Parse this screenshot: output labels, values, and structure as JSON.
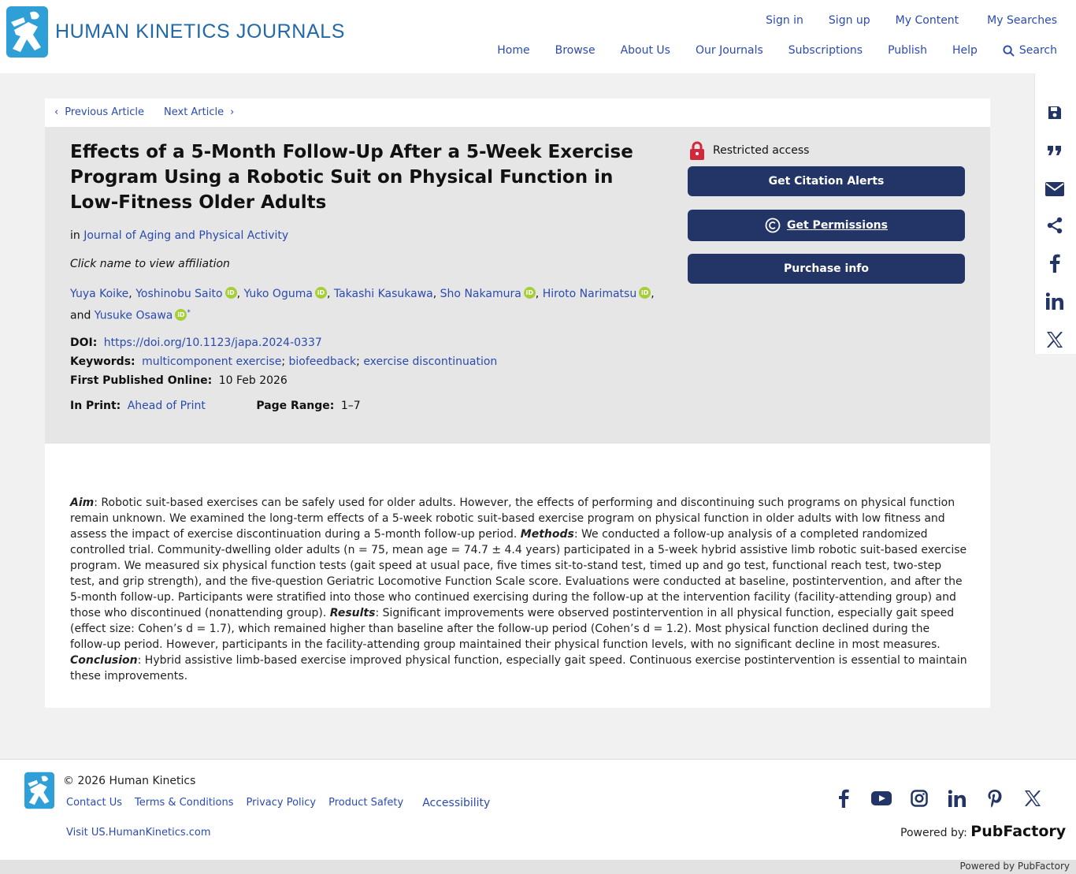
{
  "header": {
    "logo_text": "HUMAN KINETICS JOURNALS",
    "top_links": [
      "Sign in",
      "Sign up",
      "My Content",
      "My Searches"
    ],
    "main_nav": [
      "Home",
      "Browse",
      "About Us",
      "Our Journals",
      "Subscriptions",
      "Publish",
      "Help"
    ],
    "search_label": "Search"
  },
  "sidebar": {
    "icons": [
      "save-icon",
      "quote-icon",
      "email-icon",
      "share-icon",
      "facebook-icon",
      "linkedin-icon",
      "x-icon"
    ]
  },
  "article_nav": {
    "previous": "Previous Article",
    "next": "Next Article"
  },
  "article": {
    "title": "Effects of a 5-Month Follow-Up After a 5-Week Exercise Program Using a Robotic Suit on Physical Function in Low-Fitness Older Adults",
    "in_label": "in",
    "journal": "Journal of Aging and Physical Activity",
    "affiliation_hint": "Click name to view affiliation",
    "authors": [
      {
        "name": "Yuya Koike",
        "orcid": false
      },
      {
        "name": "Yoshinobu Saito",
        "orcid": true
      },
      {
        "name": "Yuko Oguma",
        "orcid": true
      },
      {
        "name": "Takashi Kasukawa",
        "orcid": false
      },
      {
        "name": "Sho Nakamura",
        "orcid": true
      },
      {
        "name": "Hiroto Narimatsu",
        "orcid": true
      },
      {
        "name": "Yusuke Osawa",
        "orcid": true,
        "corresponding": true
      }
    ],
    "and_label": "and",
    "doi_label": "DOI:",
    "doi": "https://doi.org/10.1123/japa.2024-0337",
    "keywords_label": "Keywords:",
    "keywords": [
      "multicomponent exercise",
      "biofeedback",
      "exercise discontinuation"
    ],
    "first_published_label": "First Published Online:",
    "first_published": "10 Feb 2026",
    "in_print_label": "In Print:",
    "in_print": "Ahead of Print",
    "page_range_label": "Page Range:",
    "page_range": "1–7"
  },
  "access": {
    "restricted": "Restricted access",
    "citation_alerts": "Get Citation Alerts",
    "permissions": "Get Permissions",
    "purchase": "Purchase info"
  },
  "abstract": {
    "aim_label": "Aim",
    "aim": ": Robotic suit-based exercises can be safely used for older adults. However, the effects of performing and discontinuing such programs on physical function remain unknown. We examined the long-term effects of a 5-week robotic suit-based exercise program on physical function in older adults with low fitness and assess the impact of exercise discontinuation during a 5-month follow-up period. ",
    "methods_label": "Methods",
    "methods": ": We conducted a follow-up analysis of a completed randomized controlled trial. Community-dwelling older adults (n = 75, mean age = 74.7 ± 4.4 years) participated in a 5-week hybrid assistive limb robotic suit-based exercise program. We measured six physical function tests (gait speed at usual pace, five times sit-to-stand test, timed up and go test, functional reach test, two-step test, and grip strength), and the five-question Geriatric Locomotive Function Scale score. Evaluations were conducted at baseline, postintervention, and after the 5-month follow-up. Participants were stratified into those who continued exercising during the follow-up at the intervention facility (facility-attending group) and those who discontinued (nonattending group). ",
    "results_label": "Results",
    "results": ": Significant improvements were observed postintervention in all physical function, especially gait speed (effect size: Cohen’s d = 1.7), which remained higher than baseline after the follow-up period (Cohen’s d = 1.2). Most physical function declined during the follow-up period. However, participants in the facility-attending group maintained their physical function levels, with no significant decline in most measures. ",
    "conclusion_label": "Conclusion",
    "conclusion": ": Hybrid assistive limb-based exercise improved physical function, especially gait speed. Continuous exercise postintervention is essential to maintain these improvements."
  },
  "footer": {
    "copyright": "© 2026 Human Kinetics",
    "links": [
      "Contact Us",
      "Terms & Conditions",
      "Privacy Policy",
      "Product Safety"
    ],
    "accessibility": "Accessibility",
    "visit": "Visit US.HumanKinetics.com",
    "powered_by_label": "Powered by:",
    "powered_by_brand": "PubFactory",
    "bottom_powered": "Powered by PubFactory",
    "socials": [
      "facebook-icon",
      "youtube-icon",
      "instagram-icon",
      "linkedin-icon",
      "pinterest-icon",
      "x-icon"
    ]
  },
  "colors": {
    "link": "#2a4bb0",
    "button": "#233566",
    "meta_bg": "#e6e6e6",
    "logo_blue": "#2169a8",
    "orcid": "#a6ce39",
    "lock": "#d0283c"
  }
}
